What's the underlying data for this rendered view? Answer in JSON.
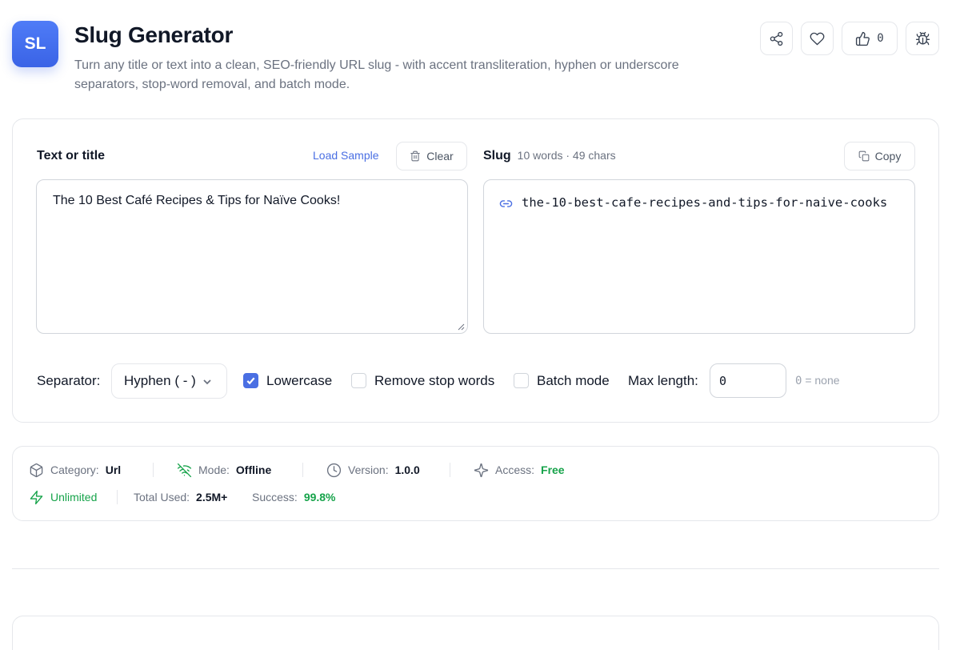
{
  "app": {
    "logo_text": "SL",
    "title": "Slug Generator",
    "subtitle": "Turn any title or text into a clean, SEO-friendly URL slug - with accent transliteration, hyphen or underscore separators, stop-word removal, and batch mode.",
    "like_count": "0"
  },
  "input": {
    "label": "Text or title",
    "load_sample": "Load Sample",
    "clear": "Clear",
    "value": "The 10 Best Café Recipes & Tips for Naïve Cooks!"
  },
  "output": {
    "label": "Slug",
    "stats": "10 words · 49 chars",
    "copy": "Copy",
    "value": "the-10-best-cafe-recipes-and-tips-for-naive-cooks"
  },
  "options": {
    "separator_label": "Separator:",
    "separator_value": "Hyphen ( - )",
    "lowercase_label": "Lowercase",
    "lowercase_checked": true,
    "stop_words_label": "Remove stop words",
    "stop_words_checked": false,
    "batch_label": "Batch mode",
    "batch_checked": false,
    "max_length_label": "Max length:",
    "max_length_value": "0",
    "max_length_hint_num": "0",
    "max_length_hint_text": " = none"
  },
  "info": {
    "category_label": "Category:",
    "category_value": "Url",
    "mode_label": "Mode:",
    "mode_value": "Offline",
    "version_label": "Version:",
    "version_value": "1.0.0",
    "access_label": "Access:",
    "access_value": "Free",
    "unlimited": "Unlimited",
    "total_used_label": "Total Used:",
    "total_used_value": "2.5M+",
    "success_label": "Success:",
    "success_value": "99.8%"
  },
  "colors": {
    "accent": "#4a6fe3",
    "success": "#16a34a",
    "border": "#e5e7eb"
  },
  "icons": [
    "share-icon",
    "heart-icon",
    "thumbs-up-icon",
    "bug-icon",
    "trash-icon",
    "copy-icon",
    "link-icon",
    "chevron-down-icon",
    "check-icon",
    "box-icon",
    "wifi-off-icon",
    "clock-icon",
    "sparkles-icon",
    "zap-icon"
  ]
}
